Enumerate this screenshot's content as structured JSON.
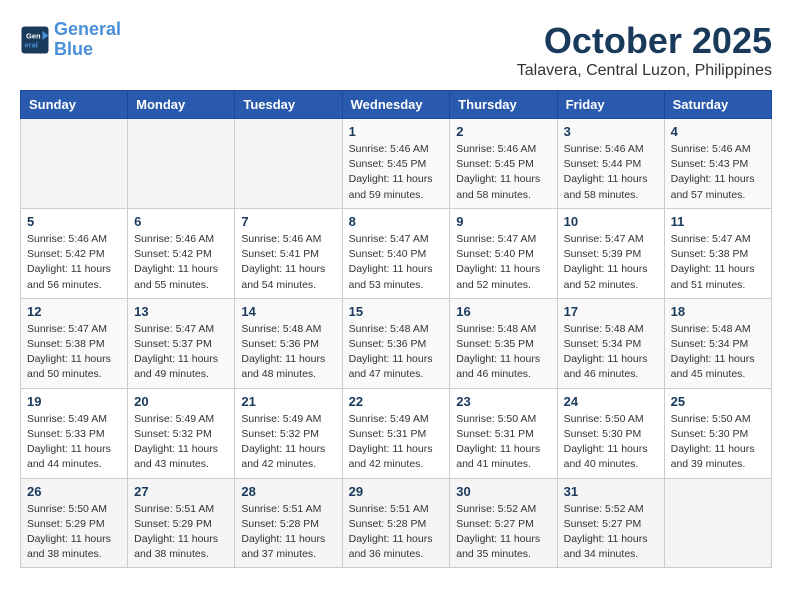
{
  "logo": {
    "line1": "General",
    "line2": "Blue"
  },
  "title": "October 2025",
  "location": "Talavera, Central Luzon, Philippines",
  "weekdays": [
    "Sunday",
    "Monday",
    "Tuesday",
    "Wednesday",
    "Thursday",
    "Friday",
    "Saturday"
  ],
  "weeks": [
    [
      {
        "day": "",
        "info": ""
      },
      {
        "day": "",
        "info": ""
      },
      {
        "day": "",
        "info": ""
      },
      {
        "day": "1",
        "info": "Sunrise: 5:46 AM\nSunset: 5:45 PM\nDaylight: 11 hours\nand 59 minutes."
      },
      {
        "day": "2",
        "info": "Sunrise: 5:46 AM\nSunset: 5:45 PM\nDaylight: 11 hours\nand 58 minutes."
      },
      {
        "day": "3",
        "info": "Sunrise: 5:46 AM\nSunset: 5:44 PM\nDaylight: 11 hours\nand 58 minutes."
      },
      {
        "day": "4",
        "info": "Sunrise: 5:46 AM\nSunset: 5:43 PM\nDaylight: 11 hours\nand 57 minutes."
      }
    ],
    [
      {
        "day": "5",
        "info": "Sunrise: 5:46 AM\nSunset: 5:42 PM\nDaylight: 11 hours\nand 56 minutes."
      },
      {
        "day": "6",
        "info": "Sunrise: 5:46 AM\nSunset: 5:42 PM\nDaylight: 11 hours\nand 55 minutes."
      },
      {
        "day": "7",
        "info": "Sunrise: 5:46 AM\nSunset: 5:41 PM\nDaylight: 11 hours\nand 54 minutes."
      },
      {
        "day": "8",
        "info": "Sunrise: 5:47 AM\nSunset: 5:40 PM\nDaylight: 11 hours\nand 53 minutes."
      },
      {
        "day": "9",
        "info": "Sunrise: 5:47 AM\nSunset: 5:40 PM\nDaylight: 11 hours\nand 52 minutes."
      },
      {
        "day": "10",
        "info": "Sunrise: 5:47 AM\nSunset: 5:39 PM\nDaylight: 11 hours\nand 52 minutes."
      },
      {
        "day": "11",
        "info": "Sunrise: 5:47 AM\nSunset: 5:38 PM\nDaylight: 11 hours\nand 51 minutes."
      }
    ],
    [
      {
        "day": "12",
        "info": "Sunrise: 5:47 AM\nSunset: 5:38 PM\nDaylight: 11 hours\nand 50 minutes."
      },
      {
        "day": "13",
        "info": "Sunrise: 5:47 AM\nSunset: 5:37 PM\nDaylight: 11 hours\nand 49 minutes."
      },
      {
        "day": "14",
        "info": "Sunrise: 5:48 AM\nSunset: 5:36 PM\nDaylight: 11 hours\nand 48 minutes."
      },
      {
        "day": "15",
        "info": "Sunrise: 5:48 AM\nSunset: 5:36 PM\nDaylight: 11 hours\nand 47 minutes."
      },
      {
        "day": "16",
        "info": "Sunrise: 5:48 AM\nSunset: 5:35 PM\nDaylight: 11 hours\nand 46 minutes."
      },
      {
        "day": "17",
        "info": "Sunrise: 5:48 AM\nSunset: 5:34 PM\nDaylight: 11 hours\nand 46 minutes."
      },
      {
        "day": "18",
        "info": "Sunrise: 5:48 AM\nSunset: 5:34 PM\nDaylight: 11 hours\nand 45 minutes."
      }
    ],
    [
      {
        "day": "19",
        "info": "Sunrise: 5:49 AM\nSunset: 5:33 PM\nDaylight: 11 hours\nand 44 minutes."
      },
      {
        "day": "20",
        "info": "Sunrise: 5:49 AM\nSunset: 5:32 PM\nDaylight: 11 hours\nand 43 minutes."
      },
      {
        "day": "21",
        "info": "Sunrise: 5:49 AM\nSunset: 5:32 PM\nDaylight: 11 hours\nand 42 minutes."
      },
      {
        "day": "22",
        "info": "Sunrise: 5:49 AM\nSunset: 5:31 PM\nDaylight: 11 hours\nand 42 minutes."
      },
      {
        "day": "23",
        "info": "Sunrise: 5:50 AM\nSunset: 5:31 PM\nDaylight: 11 hours\nand 41 minutes."
      },
      {
        "day": "24",
        "info": "Sunrise: 5:50 AM\nSunset: 5:30 PM\nDaylight: 11 hours\nand 40 minutes."
      },
      {
        "day": "25",
        "info": "Sunrise: 5:50 AM\nSunset: 5:30 PM\nDaylight: 11 hours\nand 39 minutes."
      }
    ],
    [
      {
        "day": "26",
        "info": "Sunrise: 5:50 AM\nSunset: 5:29 PM\nDaylight: 11 hours\nand 38 minutes."
      },
      {
        "day": "27",
        "info": "Sunrise: 5:51 AM\nSunset: 5:29 PM\nDaylight: 11 hours\nand 38 minutes."
      },
      {
        "day": "28",
        "info": "Sunrise: 5:51 AM\nSunset: 5:28 PM\nDaylight: 11 hours\nand 37 minutes."
      },
      {
        "day": "29",
        "info": "Sunrise: 5:51 AM\nSunset: 5:28 PM\nDaylight: 11 hours\nand 36 minutes."
      },
      {
        "day": "30",
        "info": "Sunrise: 5:52 AM\nSunset: 5:27 PM\nDaylight: 11 hours\nand 35 minutes."
      },
      {
        "day": "31",
        "info": "Sunrise: 5:52 AM\nSunset: 5:27 PM\nDaylight: 11 hours\nand 34 minutes."
      },
      {
        "day": "",
        "info": ""
      }
    ]
  ]
}
